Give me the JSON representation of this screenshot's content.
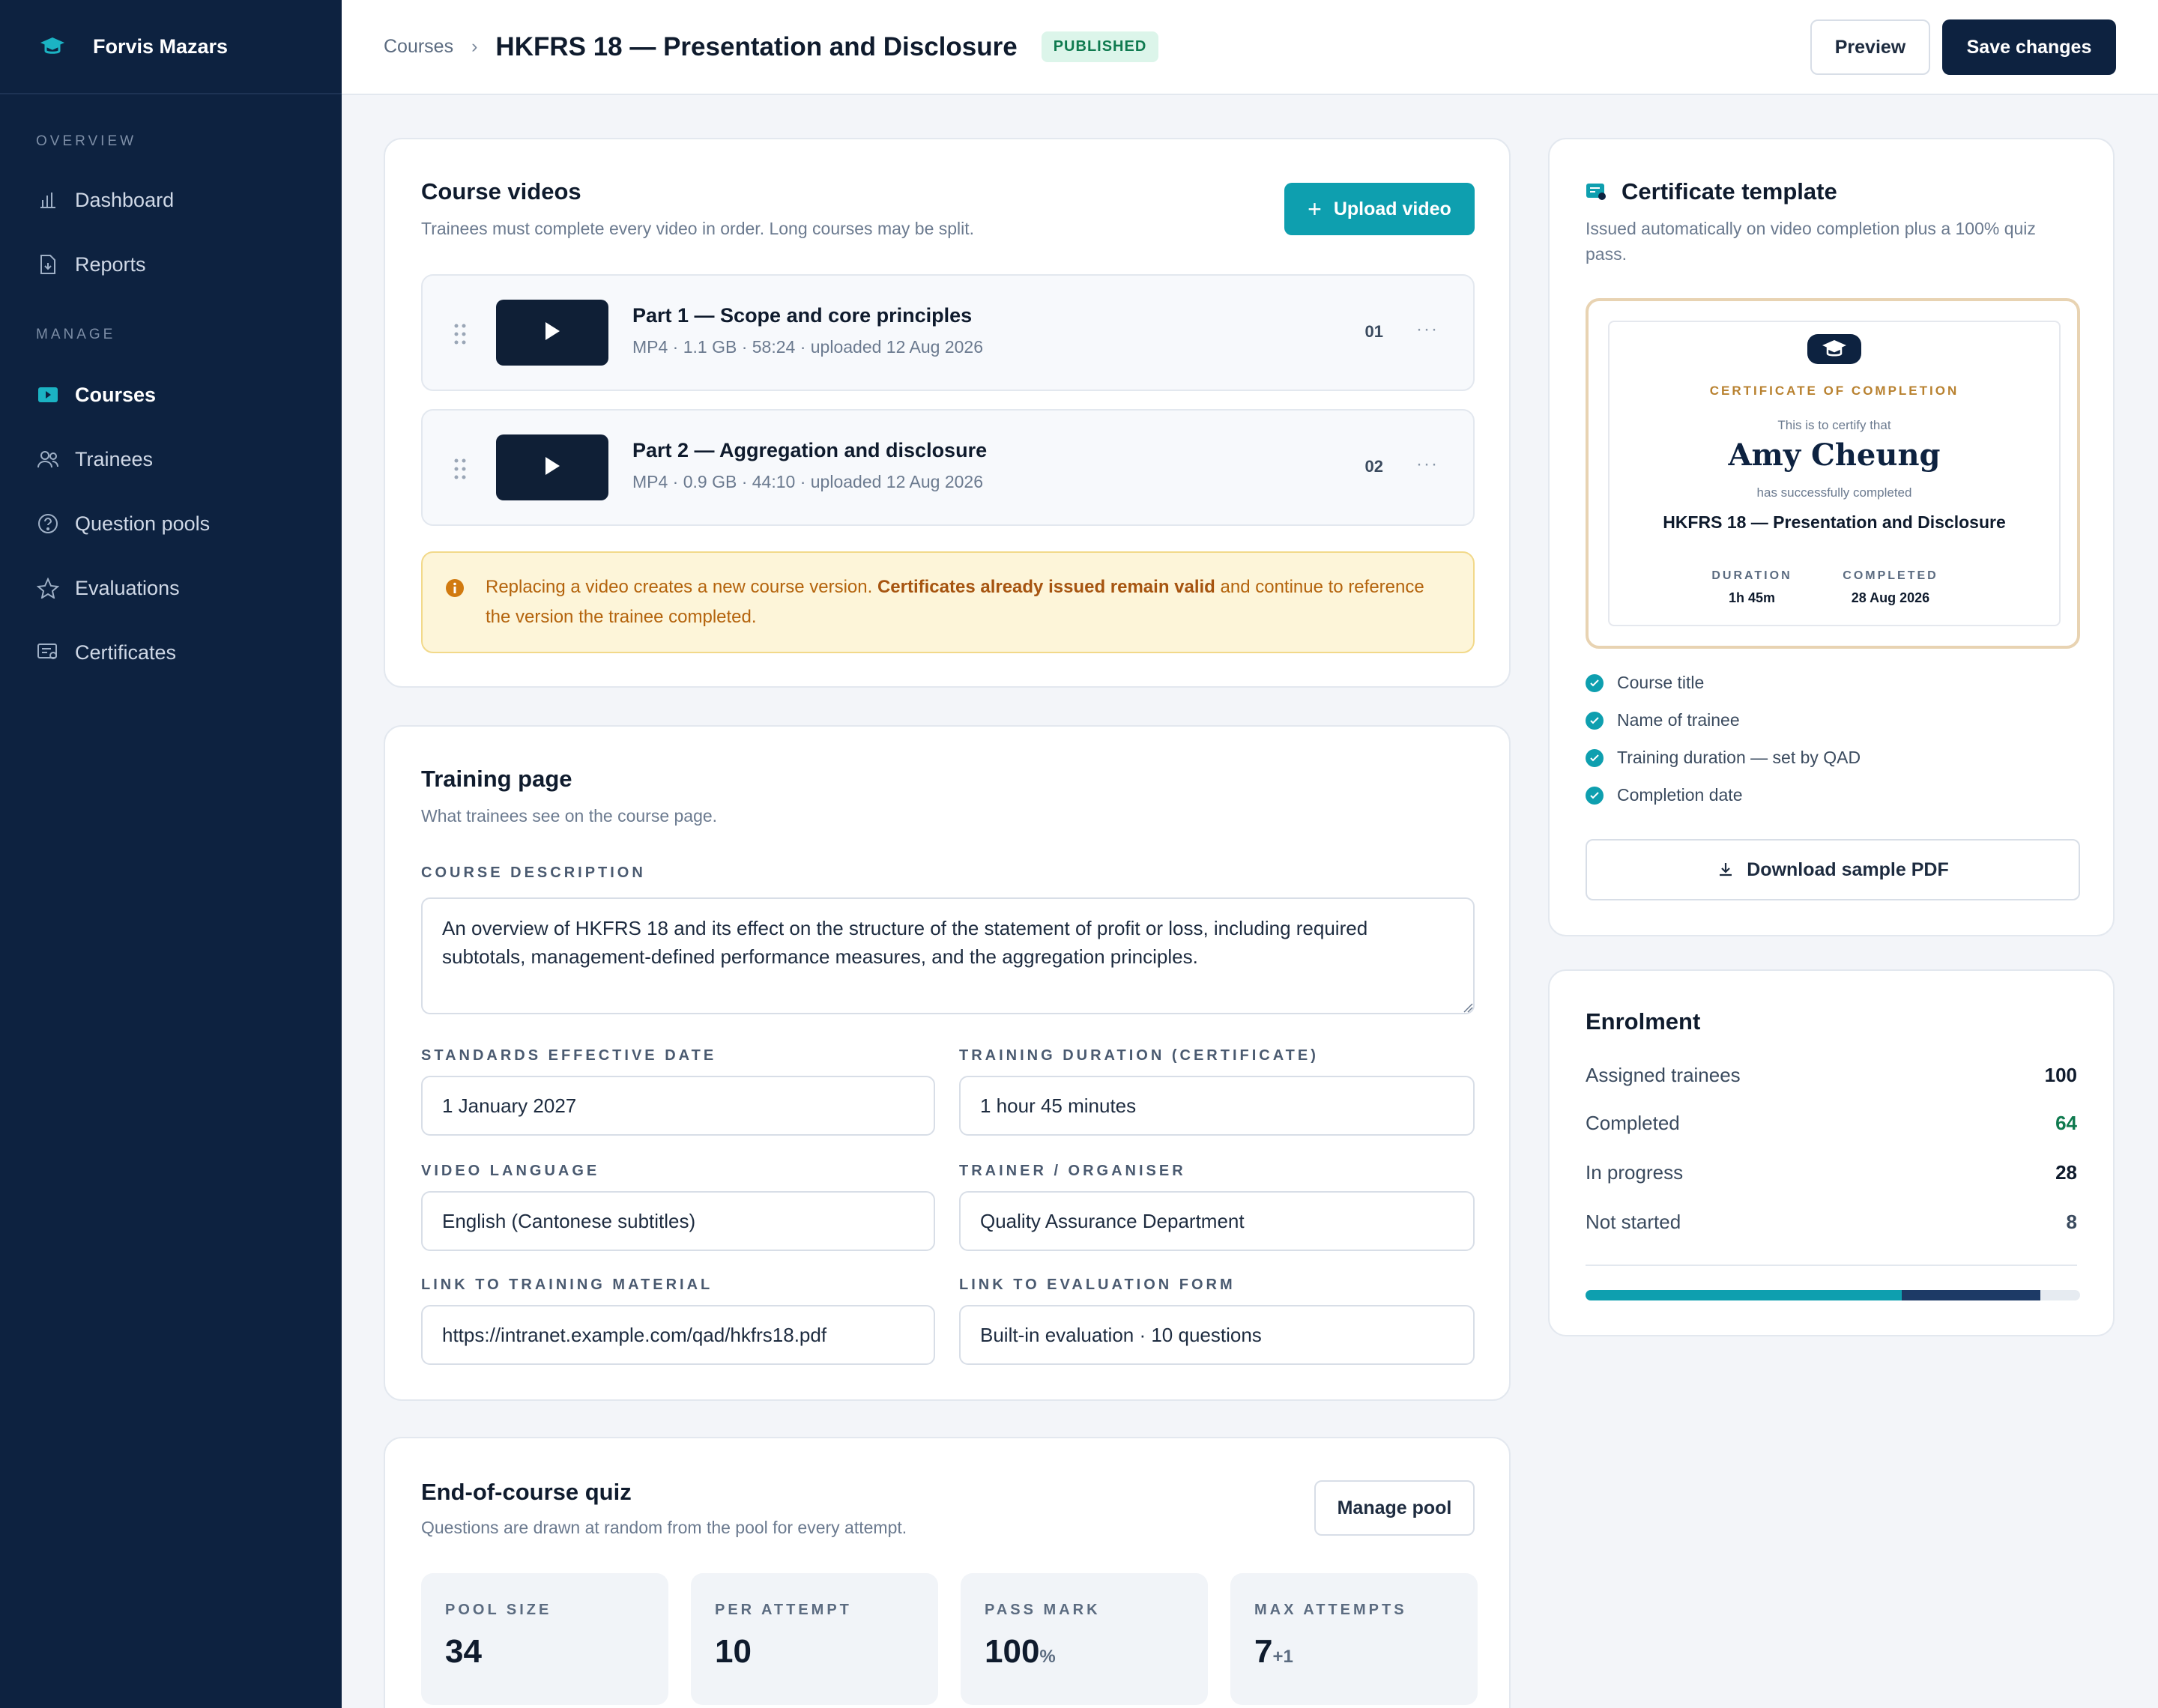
{
  "brand": {
    "name": "Forvis Mazars"
  },
  "nav": {
    "section_overview": "OVERVIEW",
    "section_manage": "MANAGE",
    "items": [
      {
        "label": "Dashboard"
      },
      {
        "label": "Reports"
      },
      {
        "label": "Courses"
      },
      {
        "label": "Trainees"
      },
      {
        "label": "Question pools"
      },
      {
        "label": "Evaluations"
      },
      {
        "label": "Certificates"
      }
    ]
  },
  "header": {
    "breadcrumb": "Courses",
    "title": "HKFRS 18 — Presentation and Disclosure",
    "status": "PUBLISHED",
    "preview_label": "Preview",
    "save_label": "Save changes"
  },
  "videos": {
    "title": "Course videos",
    "subtitle": "Trainees must complete every video in order. Long courses may be split.",
    "upload_label": "Upload video",
    "items": [
      {
        "title": "Part 1 — Scope and core principles",
        "meta": "MP4 · 1.1 GB · 58:24 · uploaded 12 Aug 2026",
        "num": "01"
      },
      {
        "title": "Part 2 — Aggregation and disclosure",
        "meta": "MP4 · 0.9 GB · 44:10 · uploaded 12 Aug 2026",
        "num": "02"
      }
    ],
    "notice_pre": "Replacing a video creates a new course version. ",
    "notice_bold": "Certificates already issued remain valid",
    "notice_post": " and continue to reference the version the trainee completed."
  },
  "training": {
    "title": "Training page",
    "subtitle": "What trainees see on the course page.",
    "description_label": "Course description",
    "description": "An overview of HKFRS 18 and its effect on the structure of the statement of profit or loss, including required subtotals, management-defined performance measures, and the aggregation principles.",
    "effective_label": "Standards effective date",
    "effective": "1 January 2027",
    "duration_label": "Training duration (certificate)",
    "duration": "1 hour 45 minutes",
    "language_label": "Video language",
    "language": "English (Cantonese subtitles)",
    "trainer_label": "Trainer / organiser",
    "trainer": "Quality Assurance Department",
    "material_label": "Link to training material",
    "material": "https://intranet.example.com/qad/hkfrs18.pdf",
    "evaluation_label": "Link to evaluation form",
    "evaluation": "Built-in evaluation · 10 questions"
  },
  "quiz": {
    "title": "End-of-course quiz",
    "subtitle": "Questions are drawn at random from the pool for every attempt.",
    "manage_label": "Manage pool",
    "stats": [
      {
        "label": "POOL SIZE",
        "value": "34",
        "suffix": ""
      },
      {
        "label": "PER ATTEMPT",
        "value": "10",
        "suffix": ""
      },
      {
        "label": "PASS MARK",
        "value": "100",
        "suffix": "%"
      },
      {
        "label": "MAX ATTEMPTS",
        "value": "7",
        "suffix": "+1"
      }
    ]
  },
  "certificate": {
    "title": "Certificate template",
    "subtitle": "Issued automatically on video completion plus a 100% quiz pass.",
    "heading": "CERTIFICATE OF COMPLETION",
    "certify": "This is to certify that",
    "name": "Amy Cheung",
    "completed_text": "has successfully completed",
    "course": "HKFRS 18 — Presentation and Disclosure",
    "duration_label": "DURATION",
    "duration": "1h 45m",
    "completed_label": "COMPLETED",
    "completed_date": "28 Aug 2026",
    "fields": [
      "Course title",
      "Name of trainee",
      "Training duration — set by QAD",
      "Completion date"
    ],
    "download_label": "Download sample PDF"
  },
  "enrolment": {
    "title": "Enrolment",
    "rows": [
      {
        "label": "Assigned trainees",
        "value": "100"
      },
      {
        "label": "Completed",
        "value": "64"
      },
      {
        "label": "In progress",
        "value": "28"
      },
      {
        "label": "Not started",
        "value": "8"
      }
    ],
    "completed_fraction": 0.64,
    "in_progress_fraction": 0.28
  },
  "colors": {
    "sidebar": "#0d2240",
    "accent": "#0e9faf",
    "completed": "#0f7a4f",
    "progress_dark": "#1d3a66"
  }
}
